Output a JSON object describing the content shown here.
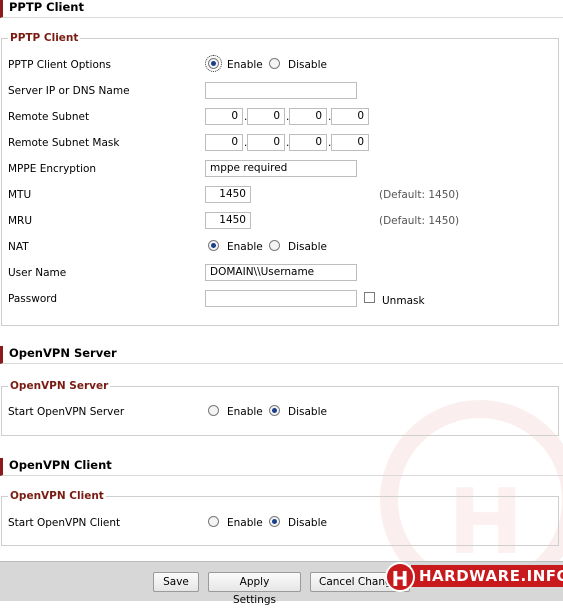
{
  "pptp": {
    "section_title": "PPTP Client",
    "legend": "PPTP Client",
    "options": {
      "label": "PPTP Client Options",
      "enable": "Enable",
      "disable": "Disable",
      "selected": "Enable"
    },
    "server": {
      "label": "Server IP or DNS Name",
      "value": ""
    },
    "remote_subnet": {
      "label": "Remote Subnet",
      "octets": [
        "0",
        "0",
        "0",
        "0"
      ]
    },
    "remote_mask": {
      "label": "Remote Subnet Mask",
      "octets": [
        "0",
        "0",
        "0",
        "0"
      ]
    },
    "mppe": {
      "label": "MPPE Encryption",
      "value": "mppe required"
    },
    "mtu": {
      "label": "MTU",
      "value": "1450",
      "default": "(Default: 1450)"
    },
    "mru": {
      "label": "MRU",
      "value": "1450",
      "default": "(Default: 1450)"
    },
    "nat": {
      "label": "NAT",
      "enable": "Enable",
      "disable": "Disable",
      "selected": "Enable"
    },
    "username": {
      "label": "User Name",
      "value": "DOMAIN\\\\Username"
    },
    "password": {
      "label": "Password",
      "value": "",
      "unmask": "Unmask"
    }
  },
  "openvpn_server": {
    "section_title": "OpenVPN Server",
    "legend": "OpenVPN Server",
    "start": {
      "label": "Start OpenVPN Server",
      "enable": "Enable",
      "disable": "Disable",
      "selected": "Disable"
    }
  },
  "openvpn_client": {
    "section_title": "OpenVPN Client",
    "legend": "OpenVPN Client",
    "start": {
      "label": "Start OpenVPN Client",
      "enable": "Enable",
      "disable": "Disable",
      "selected": "Disable"
    }
  },
  "footer": {
    "save": "Save",
    "apply": "Apply Settings",
    "cancel": "Cancel Changes"
  },
  "watermark": {
    "badge": "H",
    "text": "HARDWARE.INFO"
  },
  "colors": {
    "accent": "#8b1a1a",
    "legend": "#7a1b12",
    "footer_bg": "#d7d7d7",
    "logo_red": "#c8191c"
  }
}
